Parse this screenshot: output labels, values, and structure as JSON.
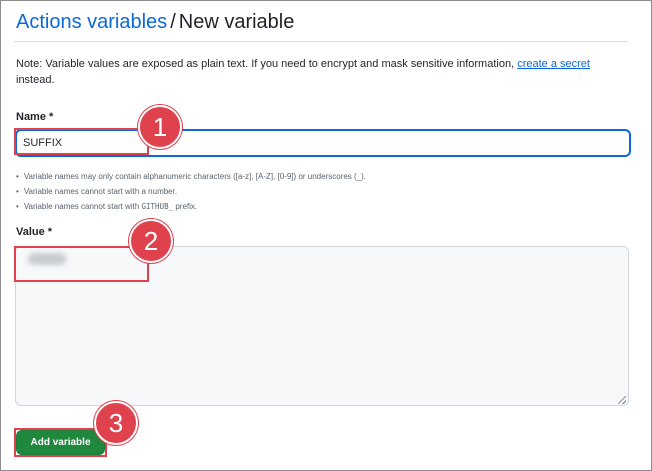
{
  "header": {
    "parent_link": "Actions variables",
    "separator": "/",
    "current": "New variable"
  },
  "note": {
    "text": "Note: Variable values are exposed as plain text. If you need to encrypt and mask sensitive information, ",
    "link": "create a secret",
    "suffix": " instead."
  },
  "name_field": {
    "label": "Name *",
    "value": "SUFFIX"
  },
  "hints": {
    "item1": "Variable names may only contain alphanumeric characters ([a-z], [A-Z], [0-9]) or underscores (_).",
    "item2": "Variable names cannot start with a number.",
    "item3_prefix": "Variable names cannot start with ",
    "item3_code": "GITHUB_",
    "item3_suffix": " prefix."
  },
  "value_field": {
    "label": "Value *",
    "value_redacted": true
  },
  "submit": {
    "label": "Add variable"
  },
  "annotations": {
    "step1": "1",
    "step2": "2",
    "step3": "3",
    "color": "#e0424d"
  },
  "colors": {
    "link": "#0969da",
    "button": "#1f883d",
    "focus_border": "#0969da"
  }
}
